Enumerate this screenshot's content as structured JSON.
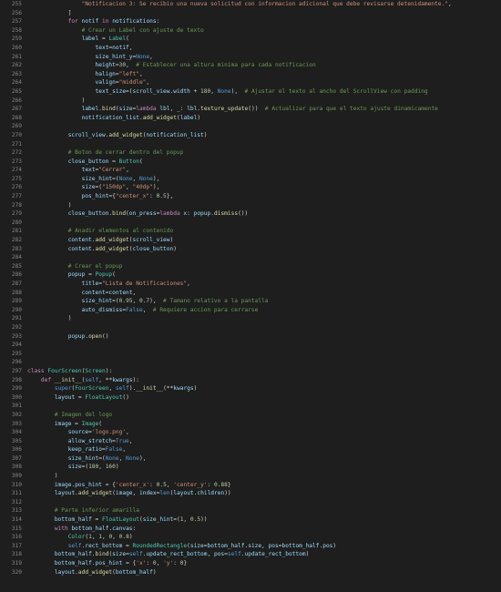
{
  "colors": {
    "keyword": "#c586c0",
    "builtin": "#569cd6",
    "function": "#dcdcaa",
    "class": "#4ec9b0",
    "string": "#ce9178",
    "number": "#b5cea8",
    "param": "#9cdcfe",
    "comment": "#6a9955",
    "text": "#d4d4d4"
  },
  "lines": [
    {
      "n": "255",
      "t": "                \"Notificacion 3: Se recibio una nueva solicitud con informacion adicional que debe revisarse detenidamente.\","
    },
    {
      "n": "256",
      "t": "            ]"
    },
    {
      "n": "257",
      "t": "            for notif in notifications:"
    },
    {
      "n": "258",
      "t": "                # Crear un Label con ajuste de texto"
    },
    {
      "n": "259",
      "t": "                label = Label("
    },
    {
      "n": "260",
      "t": "                    text=notif,"
    },
    {
      "n": "261",
      "t": "                    size_hint_y=None,"
    },
    {
      "n": "262",
      "t": "                    height=30,  # Establecer una altura minima para cada notificacion"
    },
    {
      "n": "263",
      "t": "                    halign=\"left\","
    },
    {
      "n": "264",
      "t": "                    valign=\"middle\","
    },
    {
      "n": "265",
      "t": "                    text_size=(scroll_view.width + 180, None),  # Ajustar el texto al ancho del ScrollView con padding"
    },
    {
      "n": "266",
      "t": "                )"
    },
    {
      "n": "267",
      "t": "                label.bind(size=lambda lbl, _: lbl.texture_update())  # Actualizar para que el texto ajuste dinamicamente"
    },
    {
      "n": "268",
      "t": "                notification_list.add_widget(label)"
    },
    {
      "n": "269",
      "t": ""
    },
    {
      "n": "270",
      "t": "            scroll_view.add_widget(notification_list)"
    },
    {
      "n": "271",
      "t": ""
    },
    {
      "n": "272",
      "t": "            # Boton de cerrar dentro del popup"
    },
    {
      "n": "273",
      "t": "            close_button = Button("
    },
    {
      "n": "274",
      "t": "                text=\"Cerrar\","
    },
    {
      "n": "275",
      "t": "                size_hint=(None, None),"
    },
    {
      "n": "276",
      "t": "                size=(\"150dp\", \"40dp\"),"
    },
    {
      "n": "277",
      "t": "                pos_hint={\"center_x\": 0.5},"
    },
    {
      "n": "278",
      "t": "            )"
    },
    {
      "n": "279",
      "t": "            close_button.bind(on_press=lambda x: popup.dismiss())"
    },
    {
      "n": "280",
      "t": ""
    },
    {
      "n": "281",
      "t": "            # Anadir elementos al contenido"
    },
    {
      "n": "282",
      "t": "            content.add_widget(scroll_view)"
    },
    {
      "n": "283",
      "t": "            content.add_widget(close_button)"
    },
    {
      "n": "284",
      "t": ""
    },
    {
      "n": "285",
      "t": "            # Crear el popup"
    },
    {
      "n": "286",
      "t": "            popup = Popup("
    },
    {
      "n": "287",
      "t": "                title=\"Lista de Notificaciones\","
    },
    {
      "n": "288",
      "t": "                content=content,"
    },
    {
      "n": "289",
      "t": "                size_hint=(0.95, 0.7),  # Tamano relativo a la pantalla"
    },
    {
      "n": "290",
      "t": "                auto_dismiss=False,  # Requiere accion para cerrarse"
    },
    {
      "n": "291",
      "t": "            )"
    },
    {
      "n": "292",
      "t": ""
    },
    {
      "n": "293",
      "t": "            popup.open()"
    },
    {
      "n": "294",
      "t": ""
    },
    {
      "n": "295",
      "t": ""
    },
    {
      "n": "296",
      "t": ""
    },
    {
      "n": "297",
      "t": "class FourScreen(Screen):"
    },
    {
      "n": "298",
      "t": "    def __init__(self, **kwargs):"
    },
    {
      "n": "299",
      "t": "        super(FourScreen, self).__init__(**kwargs)"
    },
    {
      "n": "300",
      "t": "        layout = FloatLayout()"
    },
    {
      "n": "301",
      "t": ""
    },
    {
      "n": "302",
      "t": "        # Imagen del logo"
    },
    {
      "n": "303",
      "t": "        image = Image("
    },
    {
      "n": "304",
      "t": "            source='logo.png',"
    },
    {
      "n": "305",
      "t": "            allow_stretch=True,"
    },
    {
      "n": "306",
      "t": "            keep_ratio=False,"
    },
    {
      "n": "307",
      "t": "            size_hint=(None, None),"
    },
    {
      "n": "308",
      "t": "            size=(180, 160)"
    },
    {
      "n": "309",
      "t": "        )"
    },
    {
      "n": "310",
      "t": "        image.pos_hint = {'center_x': 0.5, 'center_y': 0.88}"
    },
    {
      "n": "311",
      "t": "        layout.add_widget(image, index=len(layout.children))"
    },
    {
      "n": "312",
      "t": ""
    },
    {
      "n": "313",
      "t": "        # Parte inferior amarilla"
    },
    {
      "n": "314",
      "t": "        bottom_half = FloatLayout(size_hint=(1, 0.5))"
    },
    {
      "n": "315",
      "t": "        with bottom_half.canvas:"
    },
    {
      "n": "316",
      "t": "            Color(1, 1, 0, 0.8)"
    },
    {
      "n": "317",
      "t": "            self.rect_bottom = RoundedRectangle(size=bottom_half.size, pos=bottom_half.pos)"
    },
    {
      "n": "318",
      "t": "        bottom_half.bind(size=self.update_rect_bottom, pos=self.update_rect_bottom)"
    },
    {
      "n": "319",
      "t": "        bottom_half.pos_hint = {'x': 0, 'y': 0}"
    },
    {
      "n": "320",
      "t": "        layout.add_widget(bottom_half)"
    }
  ]
}
